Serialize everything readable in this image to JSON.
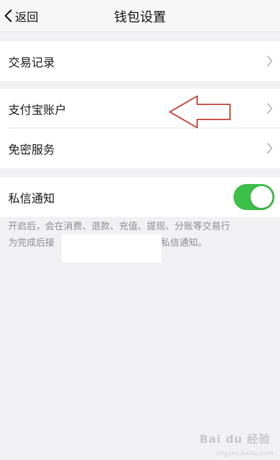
{
  "nav": {
    "back_label": "返回",
    "title": "钱包设置"
  },
  "rows": {
    "transactions": "交易记录",
    "alipay_account": "支付宝账户",
    "password_free": "免密服务",
    "private_messages": "私信通知"
  },
  "private_messages_toggle": {
    "on": true,
    "color": "#3cc04a"
  },
  "description": {
    "line1": "开启后，会在消费、退款、充值、提现、分账等交易行",
    "line2_left": "为完成后接",
    "line2_right": "的私信通知。"
  },
  "annotation": {
    "arrow_color": "#c0392b"
  },
  "watermark": {
    "text": "Bai du 经验",
    "sub": "jingyan.baidu.com"
  }
}
